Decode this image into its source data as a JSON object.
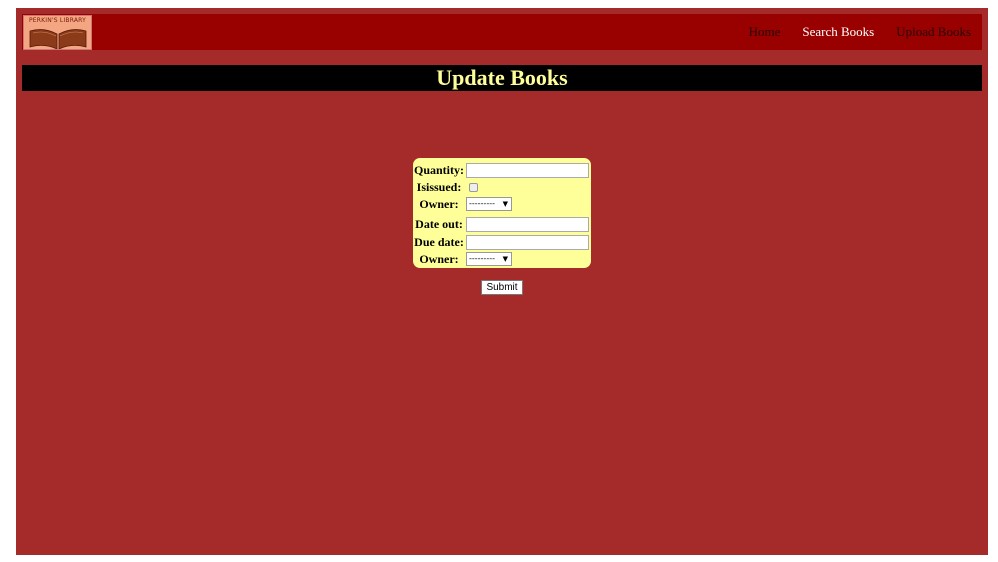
{
  "nav": {
    "logo_text": "PERKIN'S LIBRARY",
    "links": [
      {
        "label": "Home"
      },
      {
        "label": "Search Books"
      },
      {
        "label": "Upload Books"
      }
    ]
  },
  "page_title": "Update Books",
  "form": {
    "quantity_label": "Quantity:",
    "quantity_value": "",
    "isissued_label": "Isissued:",
    "owner1_label": "Owner:",
    "owner1_value": "---------",
    "dateout_label": "Date out:",
    "dateout_value": "",
    "duedate_label": "Due date:",
    "duedate_value": "",
    "owner2_label": "Owner:",
    "owner2_value": "---------",
    "submit_label": "Submit"
  },
  "colors": {
    "page_bg": "#a52a2a",
    "navbar_bg": "#990000",
    "title_bg": "#000000",
    "title_text": "#ffff99",
    "form_bg": "#ffff99"
  }
}
